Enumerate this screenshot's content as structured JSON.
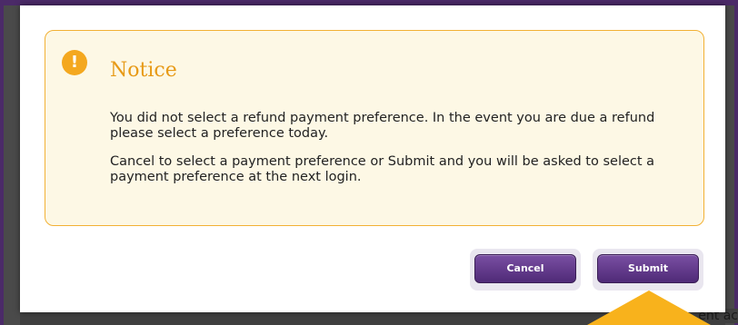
{
  "background": {
    "bottom_fragment": "ent ac"
  },
  "notice": {
    "icon": "exclamation-circle-icon",
    "title": "Notice",
    "paragraphs": [
      "You did not select a refund payment preference. In the event you are due a refund please select a preference today.",
      "Cancel to select a payment preference or Submit and you will be asked to select a payment preference at the next login."
    ]
  },
  "buttons": {
    "cancel_label": "Cancel",
    "submit_label": "Submit"
  },
  "colors": {
    "notice_border": "#f2b135",
    "notice_background": "#fdf8e5",
    "notice_title": "#e79a17",
    "button_purple": "#5e3586",
    "pointer_arrow": "#f8b21c"
  }
}
